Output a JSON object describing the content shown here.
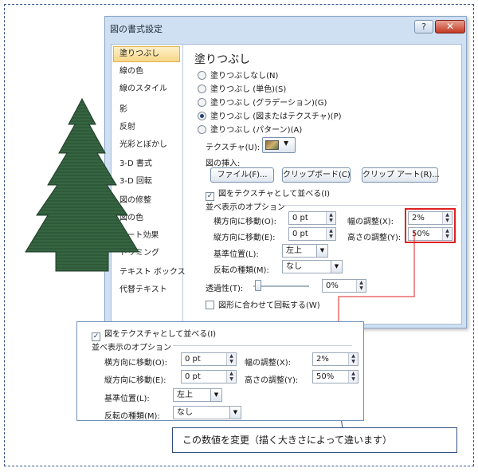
{
  "dialog": {
    "title": "図の書式設定",
    "help": "?",
    "close": "✕",
    "sidebar": [
      {
        "label": "塗りつぶし",
        "selected": true
      },
      {
        "label": "線の色"
      },
      {
        "label": "線のスタイル"
      },
      {
        "label": "影"
      },
      {
        "label": "反射"
      },
      {
        "label": "光彩とぼかし"
      },
      {
        "label": "3-D 書式"
      },
      {
        "label": "3-D 回転"
      },
      {
        "label": "図の修整"
      },
      {
        "label": "図の色"
      },
      {
        "label": "アート効果"
      },
      {
        "label": "トリミング"
      },
      {
        "label": "テキスト ボックス"
      },
      {
        "label": "代替テキスト"
      }
    ],
    "panel": {
      "heading": "塗りつぶし",
      "fill_options": [
        {
          "label": "塗りつぶしなし(N)"
        },
        {
          "label": "塗りつぶし (単色)(S)"
        },
        {
          "label": "塗りつぶし (グラデーション)(G)"
        },
        {
          "label": "塗りつぶし (図またはテクスチャ)(P)",
          "checked": true
        },
        {
          "label": "塗りつぶし (パターン)(A)"
        }
      ],
      "texture_label": "テクスチャ(U):",
      "insert_label": "図の挿入:",
      "file_button": "ファイル(F)...",
      "clipboard_button": "クリップボード(C)",
      "clipart_button": "クリップ アート(R)...",
      "tile_checkbox": "図をテクスチャとして並べる(I)",
      "tile_options_label": "並べ表示のオプション",
      "offset_x_label": "横方向に移動(O):",
      "offset_x_value": "0 pt",
      "offset_y_label": "縦方向に移動(E):",
      "offset_y_value": "0 pt",
      "scale_x_label": "幅の調整(X):",
      "scale_x_value": "2%",
      "scale_y_label": "高さの調整(Y):",
      "scale_y_value": "50%",
      "alignment_label": "基準位置(L):",
      "alignment_value": "左上",
      "mirror_label": "反転の種類(M):",
      "mirror_value": "なし",
      "transparency_label": "透過性(T):",
      "transparency_value": "0%",
      "rotate_label": "図形に合わせて回転する(W)"
    }
  },
  "zoom": {
    "tile_checkbox": "図をテクスチャとして並べる(I)",
    "tile_options_label": "並べ表示のオプション",
    "offset_x_label": "横方向に移動(O):",
    "offset_x_value": "0 pt",
    "offset_y_label": "縦方向に移動(E):",
    "offset_y_value": "0 pt",
    "scale_x_label": "幅の調整(X):",
    "scale_x_value": "2%",
    "scale_y_label": "高さの調整(Y):",
    "scale_y_value": "50%",
    "alignment_label": "基準位置(L):",
    "alignment_value": "左上",
    "mirror_label": "反転の種類(M):",
    "mirror_value": "なし"
  },
  "note": "この数値を変更（描く大きさによって違います）",
  "colors": {
    "tree": "#2e5a3a",
    "highlight": "#e02020",
    "dialog_frame": "#cfe0f2",
    "selection": "#f7d788"
  },
  "icons": {
    "tree": "evergreen-tree-illustration",
    "texture": "texture-swatch-icon"
  }
}
